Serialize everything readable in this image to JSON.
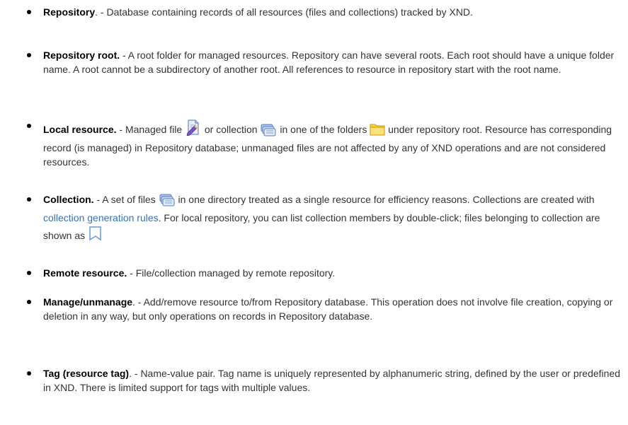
{
  "items": [
    {
      "term": "Repository",
      "text": ". - Database containing records of all resources (files and collections) tracked by XND."
    },
    {
      "term": "Repository root.",
      "text": " - A root folder for managed resources. Repository can have several roots. Each root should have a unique folder name. A root cannot be a subdirectory of another root. All references to resource in repository start with the root name."
    },
    {
      "term": "Local resource.",
      "t1": " - Managed file ",
      "t2": " or collection ",
      "t3": " in one of the folders ",
      "t4": " under repository root. Resource has corresponding record (is managed) in Repository database; unmanaged files are not affected by any of XND operations and are not considered resources."
    },
    {
      "term": "Collection.",
      "t1": " - A set of files ",
      "t2": " in one directory treated as a single resource for efficiency reasons. Collections are created with ",
      "link": "collection generation rules",
      "t3": ". For local repository, you can list collection members by double-click; files belonging to collection are shown as "
    },
    {
      "term": "Remote resource.",
      "text": " - File/collection managed by remote repository."
    },
    {
      "term": "Manage/unmanage",
      "text": ". - Add/remove resource to/from Repository database. This operation does not involve file creation, copying or deletion in any way, but only operations on records in Repository database."
    },
    {
      "term": "Tag (resource tag)",
      "text": ". - Name-value pair. Tag name is uniquely represented by alphanumeric string, defined by the user or predefined in XND. There is limited support for tags with multiple values."
    }
  ]
}
